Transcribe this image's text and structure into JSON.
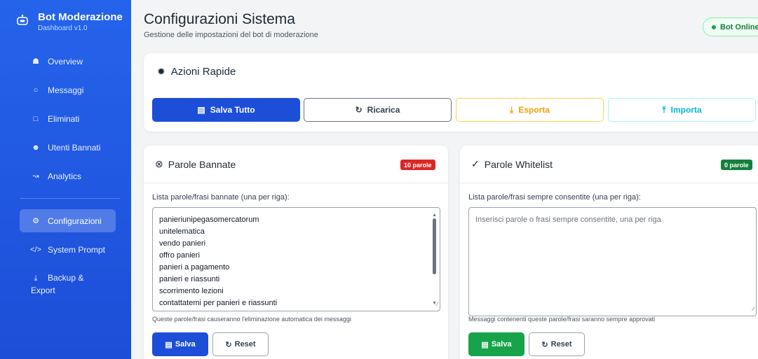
{
  "sidebar": {
    "title": "Bot Moderazione",
    "subtitle": "Dashboard v1.0",
    "items": [
      {
        "label": "Overview",
        "icon": "home-icon"
      },
      {
        "label": "Messaggi",
        "icon": "chat-icon"
      },
      {
        "label": "Eliminati",
        "icon": "trash-icon"
      },
      {
        "label": "Utenti Bannati",
        "icon": "user-ban-icon"
      },
      {
        "label": "Analytics",
        "icon": "chart-icon"
      },
      {
        "label": "Configurazioni",
        "icon": "gear-icon"
      },
      {
        "label": "System Prompt",
        "icon": "code-icon"
      },
      {
        "label": "Backup &",
        "label2": "Export",
        "icon": "download-icon"
      }
    ]
  },
  "header": {
    "title": "Configurazioni Sistema",
    "subtitle": "Gestione delle impostazioni del bot di moderazione",
    "status": "Bot Online"
  },
  "quick_actions": {
    "title": "Azioni Rapide",
    "save_all": "Salva Tutto",
    "reload": "Ricarica",
    "export": "Esporta",
    "import": "Importa"
  },
  "banned": {
    "title": "Parole Bannate",
    "badge": "10 parole",
    "label": "Lista parole/frasi bannate (una per riga):",
    "lines": [
      "panieriunipegasomercatorum",
      "unitelematica",
      "vendo panieri",
      "offro panieri",
      "panieri a pagamento",
      "panieri e riassunti",
      "scorrimento lezioni",
      "contattatemi per panieri e riassunti"
    ],
    "help": "Queste parole/frasi causeranno l'eliminazione automatica dei messaggi",
    "save": "Salva",
    "reset": "Reset"
  },
  "whitelist": {
    "title": "Parole Whitelist",
    "badge": "0 parole",
    "label": "Lista parole/frasi sempre consentite (una per riga):",
    "placeholder": "Inserisci parole o frasi sempre consentite, una per riga",
    "help": "Messaggi contenenti queste parole/frasi saranno sempre approvati",
    "save": "Salva",
    "reset": "Reset"
  },
  "colors": {
    "sidebar": "#2563eb",
    "primary": "#1d4ed8",
    "success": "#16a34a",
    "danger": "#dc2626",
    "warning": "#f59e0b",
    "info": "#06b6d4"
  }
}
